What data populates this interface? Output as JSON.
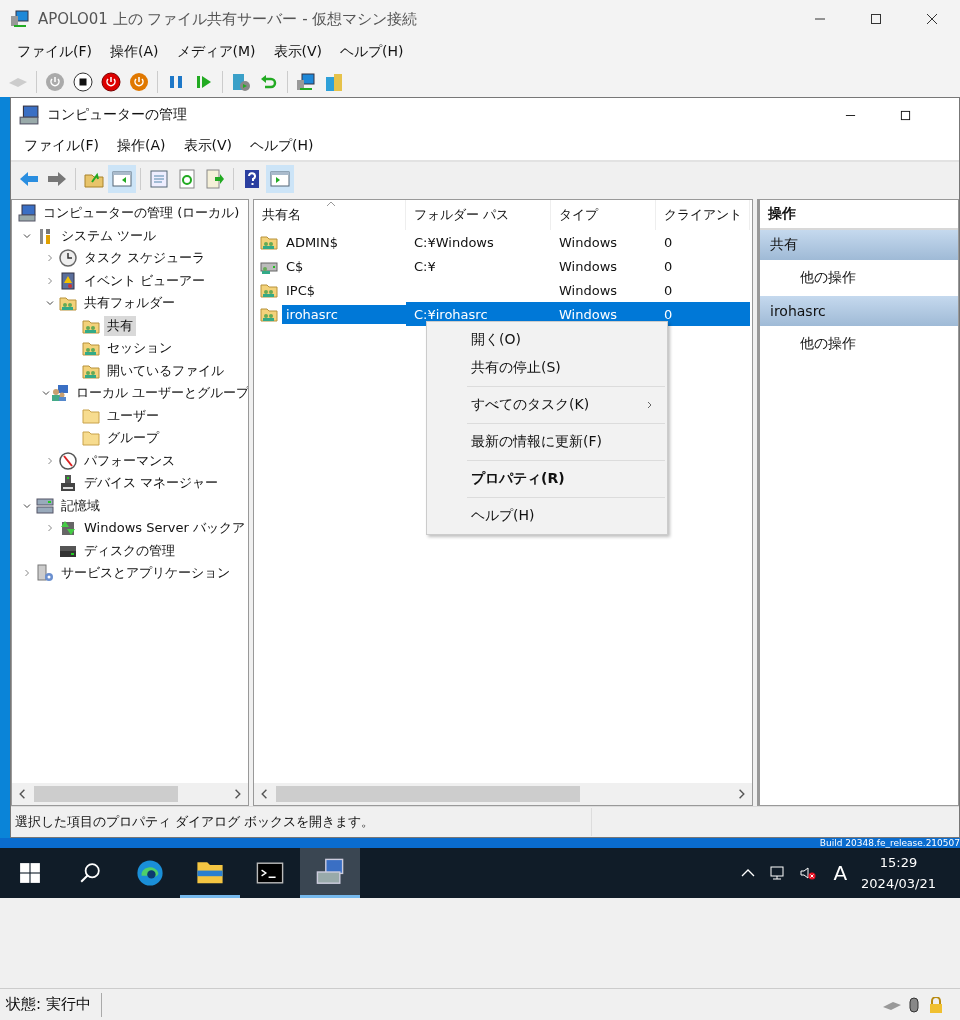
{
  "window": {
    "title": "APOLO01 上の ファイル共有サーバー - 仮想マシン接続"
  },
  "menu": [
    "ファイル(F)",
    "操作(A)",
    "メディア(M)",
    "表示(V)",
    "ヘルプ(H)"
  ],
  "vm_toolbar": [
    [
      {
        "kind": "ctrl-alt-del",
        "disabled": true
      }
    ],
    [
      {
        "kind": "start",
        "disabled": true
      },
      {
        "kind": "turn-off",
        "disabled": false
      },
      {
        "kind": "shut-down",
        "disabled": false
      },
      {
        "kind": "power",
        "disabled": false
      }
    ],
    [
      {
        "kind": "pause",
        "disabled": false
      },
      {
        "kind": "resume",
        "disabled": false
      }
    ],
    [
      {
        "kind": "checkpoint",
        "disabled": false
      },
      {
        "kind": "revert",
        "disabled": false
      }
    ],
    [
      {
        "kind": "enhanced",
        "disabled": false
      },
      {
        "kind": "share",
        "disabled": false
      }
    ]
  ],
  "mmc": {
    "title": "コンピューターの管理",
    "menu": [
      "ファイル(F)",
      "操作(A)",
      "表示(V)",
      "ヘルプ(H)"
    ],
    "toolbar": [
      [
        {
          "kind": "back",
          "pressed": false
        },
        {
          "kind": "forward",
          "pressed": false
        }
      ],
      [
        {
          "kind": "up",
          "pressed": false
        },
        {
          "kind": "console-tree",
          "pressed": true
        }
      ],
      [
        {
          "kind": "properties",
          "pressed": false
        },
        {
          "kind": "refresh",
          "pressed": false
        },
        {
          "kind": "export",
          "pressed": false
        }
      ],
      [
        {
          "kind": "help",
          "pressed": false
        },
        {
          "kind": "action-pane",
          "pressed": true
        }
      ]
    ],
    "tree": [
      {
        "label": "コンピューターの管理 (ローカル)",
        "kind": "computer",
        "selected": false,
        "children": [
          {
            "label": "システム ツール",
            "kind": "tools",
            "expanded": true,
            "selected": false,
            "children": [
              {
                "label": "タスク スケジューラ",
                "kind": "clock",
                "expanded": false,
                "selected": false
              },
              {
                "label": "イベント ビューアー",
                "kind": "event",
                "expanded": false,
                "selected": false
              },
              {
                "label": "共有フォルダー",
                "kind": "share",
                "expanded": true,
                "selected": false,
                "children": [
                  {
                    "label": "共有",
                    "kind": "share",
                    "selected": true
                  },
                  {
                    "label": "セッション",
                    "kind": "share",
                    "selected": false
                  },
                  {
                    "label": "開いているファイル",
                    "kind": "share",
                    "selected": false
                  }
                ]
              },
              {
                "label": "ローカル ユーザーとグループ",
                "kind": "users",
                "expanded": true,
                "selected": false,
                "children": [
                  {
                    "label": "ユーザー",
                    "kind": "folder",
                    "selected": false
                  },
                  {
                    "label": "グループ",
                    "kind": "folder",
                    "selected": false
                  }
                ]
              },
              {
                "label": "パフォーマンス",
                "kind": "gauge",
                "expanded": false,
                "selected": false
              },
              {
                "label": "デバイス マネージャー",
                "kind": "device",
                "selected": false
              }
            ]
          },
          {
            "label": "記憶域",
            "kind": "storage",
            "expanded": true,
            "selected": false,
            "children": [
              {
                "label": "Windows Server バックア",
                "kind": "backup",
                "expanded": false,
                "selected": false
              },
              {
                "label": "ディスクの管理",
                "kind": "disk",
                "selected": false
              }
            ]
          },
          {
            "label": "サービスとアプリケーション",
            "kind": "services",
            "expanded": false,
            "selected": false
          }
        ]
      }
    ],
    "columns": [
      {
        "label": "共有名",
        "sorted": true
      },
      {
        "label": "フォルダー パス",
        "sorted": false
      },
      {
        "label": "タイプ",
        "sorted": false
      },
      {
        "label": "クライアント",
        "sorted": false
      }
    ],
    "rows": [
      {
        "kind": "share",
        "name": "ADMIN$",
        "path": "C:¥Windows",
        "type": "Windows",
        "clients": "0",
        "selected": false
      },
      {
        "kind": "drive-share",
        "name": "C$",
        "path": "C:¥",
        "type": "Windows",
        "clients": "0",
        "selected": false
      },
      {
        "kind": "share",
        "name": "IPC$",
        "type": "Windows",
        "clients": "0",
        "selected": false
      },
      {
        "kind": "share",
        "name": "irohasrc",
        "path": "C:¥irohasrc",
        "type": "Windows",
        "clients": "0",
        "selected": true
      }
    ],
    "context_menu": [
      [
        {
          "label": "開く(O)",
          "bold": false,
          "submenu": false
        },
        {
          "label": "共有の停止(S)",
          "bold": false,
          "submenu": false
        }
      ],
      [
        {
          "label": "すべてのタスク(K)",
          "bold": false,
          "submenu": true
        }
      ],
      [
        {
          "label": "最新の情報に更新(F)",
          "bold": false,
          "submenu": false
        }
      ],
      [
        {
          "label": "プロパティ(R)",
          "bold": true,
          "submenu": false
        }
      ],
      [
        {
          "label": "ヘルプ(H)",
          "bold": false,
          "submenu": false
        }
      ]
    ],
    "actions": {
      "title": "操作",
      "sections": [
        {
          "title": "共有",
          "items": [
            "他の操作"
          ]
        },
        {
          "title": "irohasrc",
          "items": [
            "他の操作"
          ]
        }
      ]
    },
    "status": "選択した項目のプロパティ ダイアログ ボックスを開きます。"
  },
  "desktop": {
    "build_text": "Build 20348.fe_release.210507"
  },
  "taskbar": {
    "apps": [
      {
        "kind": "start",
        "running": false,
        "selected": false
      },
      {
        "kind": "search",
        "running": false,
        "selected": false
      },
      {
        "kind": "browser",
        "running": false,
        "selected": false
      },
      {
        "kind": "explorer",
        "running": true,
        "selected": false
      },
      {
        "kind": "terminal",
        "running": false,
        "selected": false
      },
      {
        "kind": "mmc",
        "running": true,
        "selected": true
      }
    ],
    "ime": "A",
    "time": "15:29",
    "date": "2024/03/21"
  },
  "status_bar": {
    "state": "状態: 実行中"
  }
}
